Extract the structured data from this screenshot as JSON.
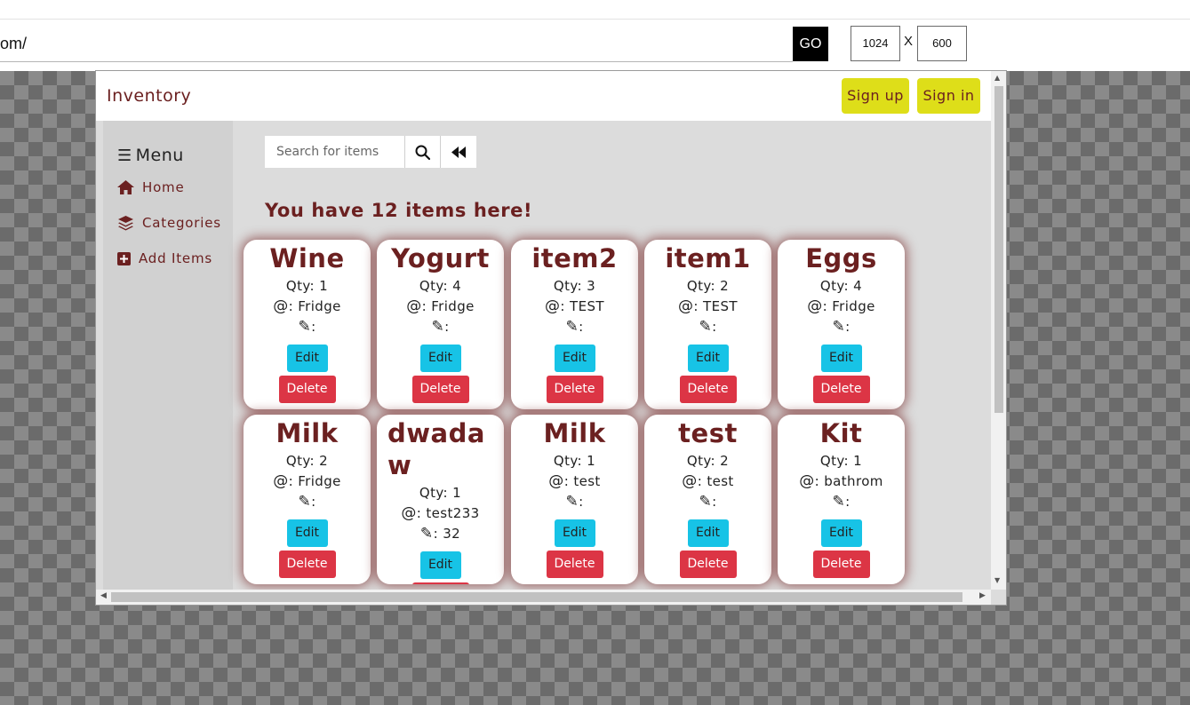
{
  "browser": {
    "url": "om/",
    "go_label": "GO",
    "width_value": "1024",
    "x_label": "X",
    "height_value": "600"
  },
  "navbar": {
    "brand": "Inventory",
    "signup_label": "Sign up",
    "signin_label": "Sign in",
    "button_color": "#dede19",
    "brand_color": "#6b2020"
  },
  "sidebar": {
    "menu_title": "Menu",
    "items": [
      {
        "label": "Home",
        "icon": "home-icon"
      },
      {
        "label": "Categories",
        "icon": "layers-icon"
      },
      {
        "label": "Add Items",
        "icon": "plus-square-icon"
      }
    ]
  },
  "search": {
    "placeholder": "Search for items"
  },
  "headline": "You have 12 items here!",
  "card_labels": {
    "qty_prefix": "Qty: ",
    "location_glyph": "@",
    "note_glyph": "✎",
    "edit": "Edit",
    "delete": "Delete"
  },
  "items": [
    {
      "name": "Wine",
      "qty": "1",
      "location": "Fridge",
      "note": ""
    },
    {
      "name": "Yogurt",
      "qty": "4",
      "location": "Fridge",
      "note": ""
    },
    {
      "name": "item2",
      "qty": "3",
      "location": "TEST",
      "note": ""
    },
    {
      "name": "item1",
      "qty": "2",
      "location": "TEST",
      "note": ""
    },
    {
      "name": "Eggs",
      "qty": "4",
      "location": "Fridge",
      "note": ""
    },
    {
      "name": "Milk",
      "qty": "2",
      "location": "Fridge",
      "note": ""
    },
    {
      "name": "dwadaw",
      "qty": "1",
      "location": "test233",
      "note": "32"
    },
    {
      "name": "Milk",
      "qty": "1",
      "location": "test",
      "note": ""
    },
    {
      "name": "test",
      "qty": "2",
      "location": "test",
      "note": ""
    },
    {
      "name": "Kit",
      "qty": "1",
      "location": "bathrom",
      "note": ""
    }
  ],
  "colors": {
    "edit_button": "#17c3e6",
    "delete_button": "#dc3545",
    "accent_text": "#6b2020"
  }
}
